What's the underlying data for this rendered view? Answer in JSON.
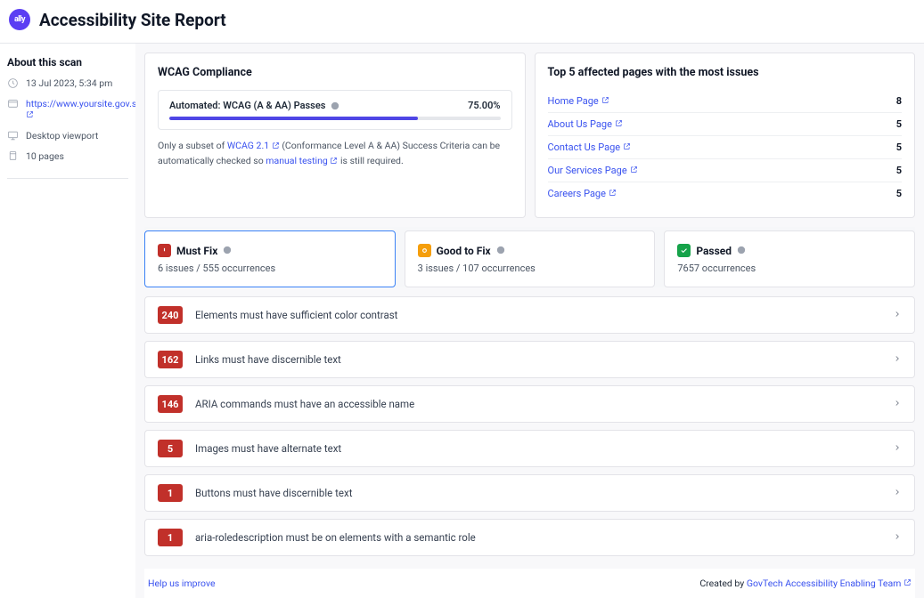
{
  "header": {
    "logo_text": "ally",
    "title": "Accessibility Site Report"
  },
  "sidebar": {
    "title": "About this scan",
    "items": [
      {
        "text": "13 Jul 2023, 5:34 pm"
      },
      {
        "text": "https://www.yoursite.gov.sg/",
        "link": true
      },
      {
        "text": "Desktop viewport"
      },
      {
        "text": "10 pages"
      }
    ]
  },
  "wcag": {
    "title": "WCAG Compliance",
    "progress_label": "Automated: WCAG (A & AA) Passes",
    "progress_pct_text": "75.00%",
    "progress_pct": 75,
    "note_pre": "Only a subset of ",
    "note_link1": "WCAG 2.1",
    "note_mid": " (Conformance Level A & AA) Success Criteria can be automatically checked so ",
    "note_link2": "manual testing",
    "note_post": " is still required."
  },
  "top5": {
    "title": "Top 5 affected pages with the most issues",
    "items": [
      {
        "name": "Home Page",
        "count": "8"
      },
      {
        "name": "About Us Page",
        "count": "5"
      },
      {
        "name": "Contact Us Page",
        "count": "5"
      },
      {
        "name": "Our Services Page",
        "count": "5"
      },
      {
        "name": "Careers Page",
        "count": "5"
      }
    ]
  },
  "tabs": {
    "must_fix": {
      "title": "Must Fix",
      "sub": "6 issues / 555 occurrences"
    },
    "good_to_fix": {
      "title": "Good to Fix",
      "sub": "3 issues / 107 occurrences"
    },
    "passed": {
      "title": "Passed",
      "sub": "7657 occurrences"
    }
  },
  "issues": [
    {
      "count": "240",
      "text": "Elements must have sufficient color contrast"
    },
    {
      "count": "162",
      "text": "Links must have discernible text"
    },
    {
      "count": "146",
      "text": "ARIA commands must have an accessible name"
    },
    {
      "count": "5",
      "text": "Images must have alternate text"
    },
    {
      "count": "1",
      "text": "Buttons must have discernible text"
    },
    {
      "count": "1",
      "text": "aria-roledescription must be on elements with a semantic role"
    }
  ],
  "footer": {
    "help": "Help us improve",
    "created_by_pre": "Created by ",
    "created_by_link": "GovTech Accessibility Enabling Team"
  }
}
